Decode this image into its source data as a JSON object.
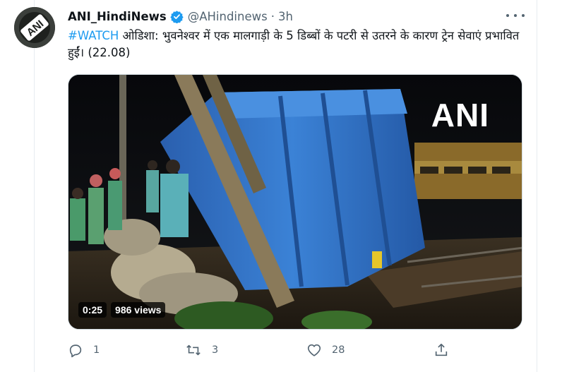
{
  "tweet": {
    "author": {
      "display_name": "ANI_HindiNews",
      "handle": "@AHindinews",
      "verified": true,
      "avatar_text": "ANI"
    },
    "separator": "·",
    "time": "3h",
    "text": {
      "hashtag": "#WATCH",
      "body": " ओडिशा: भुवनेश्वर में एक मालगाड़ी के 5 डिब्बों के पटरी से उतरने के कारण ट्रेन सेवाएं प्रभावित हुईं। (22.08)"
    },
    "media": {
      "watermark": "ANI",
      "duration": "0:25",
      "views": "986 views"
    },
    "actions": {
      "replies": "1",
      "retweets": "3",
      "likes": "28"
    }
  },
  "colors": {
    "accent": "#1d9bf0",
    "muted": "#536471",
    "text": "#0f1419",
    "wagon_blue": "#2f6fc0"
  }
}
